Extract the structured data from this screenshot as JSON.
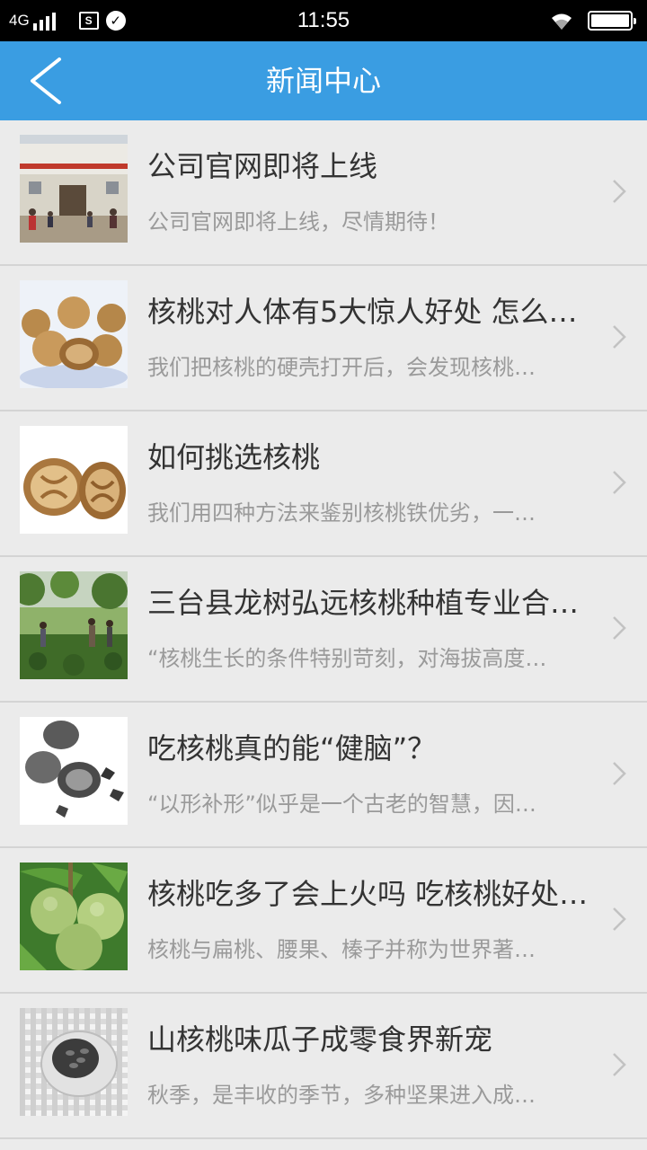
{
  "status_bar": {
    "network": "4G",
    "time": "11:55",
    "icons": [
      "signal-icon",
      "sim-icon",
      "check-icon",
      "wifi-icon",
      "battery-icon"
    ],
    "battery_level": 1.0
  },
  "header": {
    "title": "新闻中心",
    "background": "#3a9de2"
  },
  "news": [
    {
      "title": "公司官网即将上线",
      "desc": "公司官网即将上线，尽情期待！",
      "thumb": "building-photo"
    },
    {
      "title": "核桃对人体有5大惊人好处 怎么…",
      "desc": "我们把核桃的硬壳打开后，会发现核桃…",
      "thumb": "walnut-pile-photo"
    },
    {
      "title": "如何挑选核桃",
      "desc": "我们用四种方法来鉴别核桃铁优劣，一…",
      "thumb": "cracked-walnut-photo"
    },
    {
      "title": "三台县龙树弘远核桃种植专业合…",
      "desc": "“核桃生长的条件特别苛刻，对海拔高度…",
      "thumb": "orchard-photo"
    },
    {
      "title": "吃核桃真的能“健脑”？",
      "desc": "“以形补形”似乎是一个古老的智慧，因…",
      "thumb": "bw-walnut-photo"
    },
    {
      "title": "核桃吃多了会上火吗 吃核桃好处…",
      "desc": "核桃与扁桃、腰果、榛子并称为世界著…",
      "thumb": "green-walnut-photo"
    },
    {
      "title": "山核桃味瓜子成零食界新宠",
      "desc": "秋季，是丰收的季节，多种坚果进入成…",
      "thumb": "seeds-bowl-photo"
    }
  ]
}
